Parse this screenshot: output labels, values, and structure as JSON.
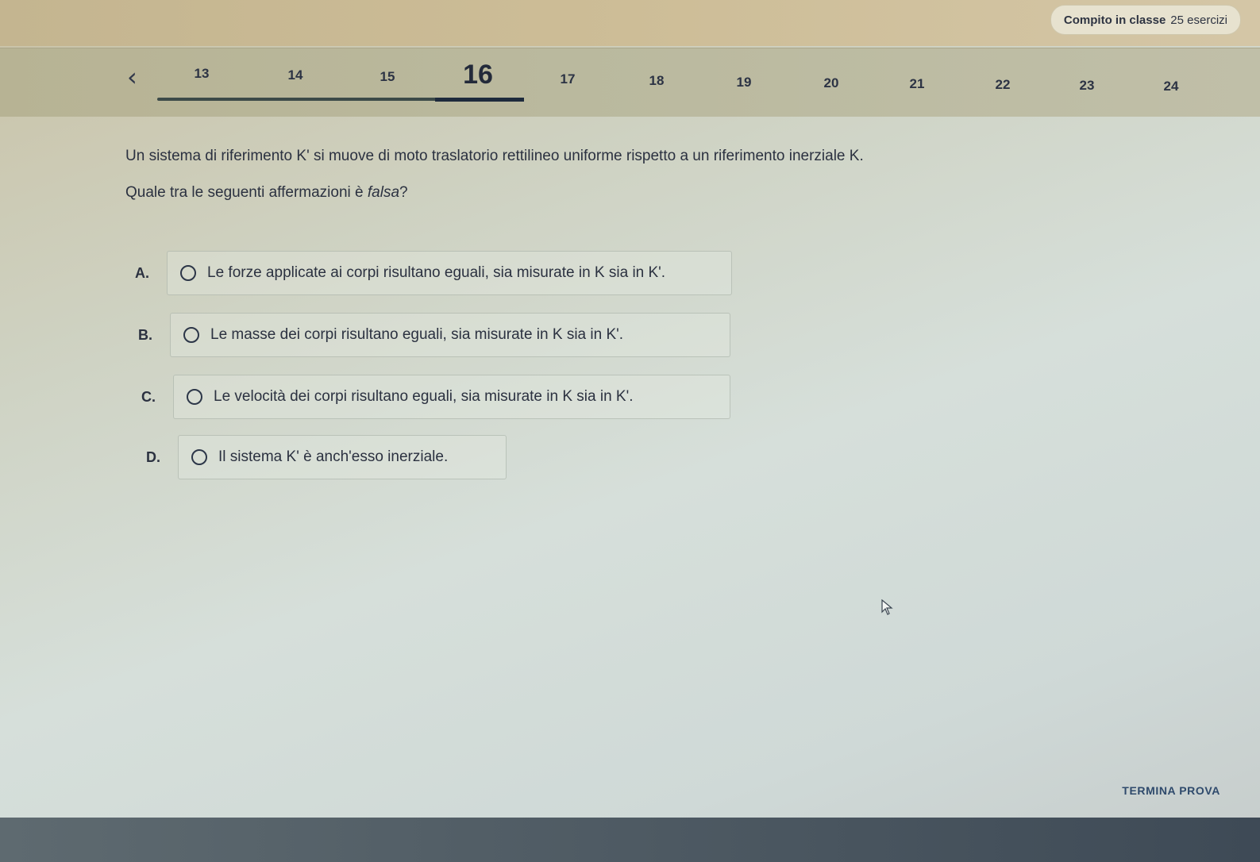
{
  "header": {
    "title": "Compito in classe",
    "count": "25 esercizi"
  },
  "nav": {
    "prev_icon": "chevron-left",
    "prev_glyph": "‹",
    "items": [
      "13",
      "14",
      "15",
      "16",
      "17",
      "18",
      "19",
      "20",
      "21",
      "22",
      "23",
      "24"
    ],
    "current": "16"
  },
  "question": {
    "text": "Un sistema di riferimento K' si muove di moto traslatorio rettilineo uniforme rispetto a un riferimento inerziale K.",
    "prompt_before": "Quale tra le seguenti affermazioni è ",
    "prompt_emph": "falsa",
    "prompt_after": "?"
  },
  "options": [
    {
      "letter": "A.",
      "text": "Le forze applicate ai corpi risultano eguali, sia misurate in K sia in K'."
    },
    {
      "letter": "B.",
      "text": "Le masse dei corpi risultano eguali, sia misurate in K sia in K'."
    },
    {
      "letter": "C.",
      "text": "Le velocità dei corpi risultano eguali, sia misurate in K sia in K'."
    },
    {
      "letter": "D.",
      "text": "Il sistema K' è anch'esso inerziale."
    }
  ],
  "footer": {
    "finish_label": "TERMINA PROVA"
  },
  "colors": {
    "accent": "#2f4a6c",
    "text": "#2b3140"
  }
}
